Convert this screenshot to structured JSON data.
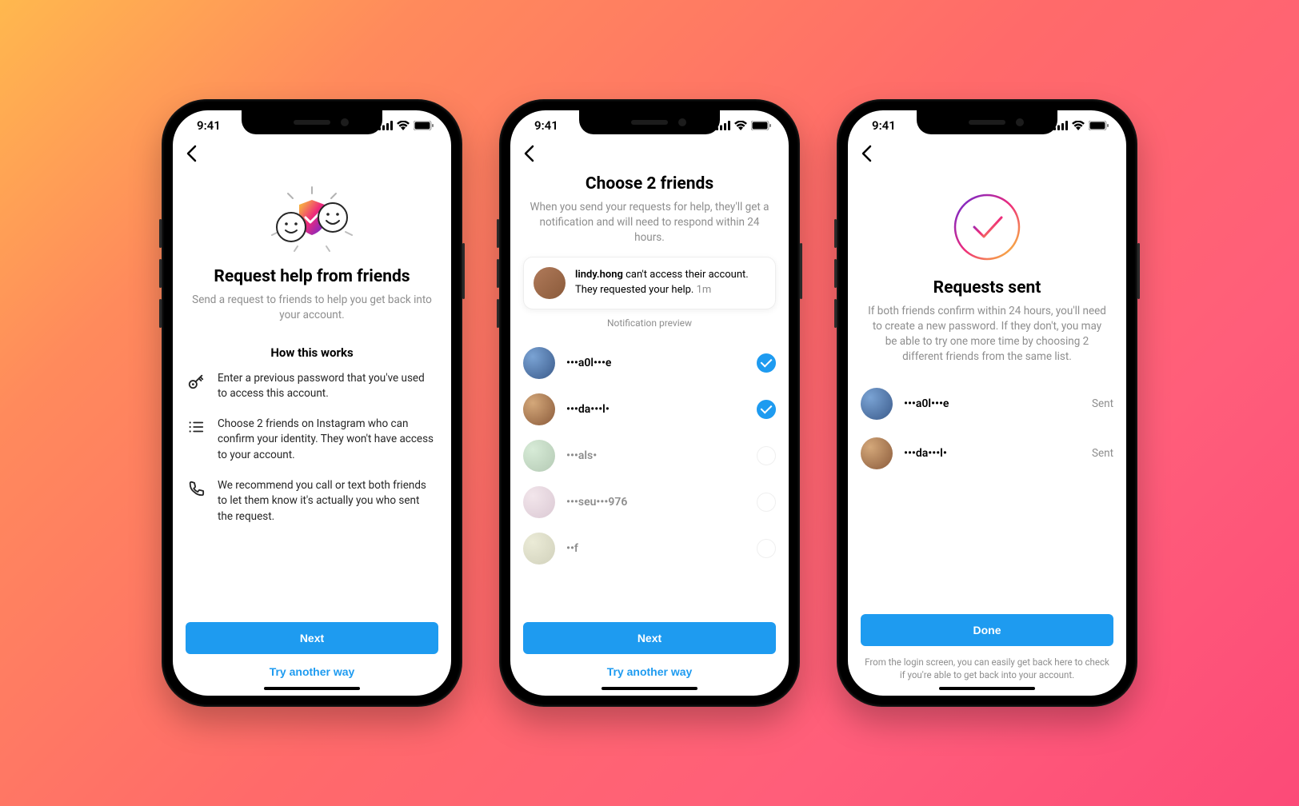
{
  "status": {
    "time": "9:41"
  },
  "screen1": {
    "title": "Request help from friends",
    "subtitle": "Send a request to friends to help you get back into your account.",
    "section": "How this works",
    "steps": [
      "Enter a previous password that you've used to access this account.",
      "Choose 2 friends on Instagram who can confirm your identity. They won't have access to your account.",
      "We recommend you call or text both friends to let them know it's actually you who sent the request."
    ],
    "next": "Next",
    "alt": "Try another way"
  },
  "screen2": {
    "title": "Choose 2 friends",
    "subtitle": "When you send your requests for help, they'll get a notification and will need to respond within 24 hours.",
    "notif_user": "lindy.hong",
    "notif_body": " can't access their account. They requested your help. ",
    "notif_time": "1m",
    "preview_label": "Notification preview",
    "friends": [
      {
        "name": "•••a0l•••e",
        "selected": true,
        "faded": false
      },
      {
        "name": "•••da•••l•",
        "selected": true,
        "faded": false
      },
      {
        "name": "•••als•",
        "selected": false,
        "faded": true
      },
      {
        "name": "•••seu•••976",
        "selected": false,
        "faded": true
      },
      {
        "name": "••f",
        "selected": false,
        "faded": true
      }
    ],
    "next": "Next",
    "alt": "Try another way"
  },
  "screen3": {
    "title": "Requests sent",
    "subtitle": "If both friends confirm within 24 hours, you'll need to create a new password. If they don't, you may be able to try one more time by choosing 2 different friends from the same list.",
    "sent": [
      {
        "name": "•••a0l•••e",
        "status": "Sent"
      },
      {
        "name": "•••da•••l•",
        "status": "Sent"
      }
    ],
    "done": "Done",
    "note": "From the login screen, you can easily get back here to check if you're able to get back into your account."
  }
}
